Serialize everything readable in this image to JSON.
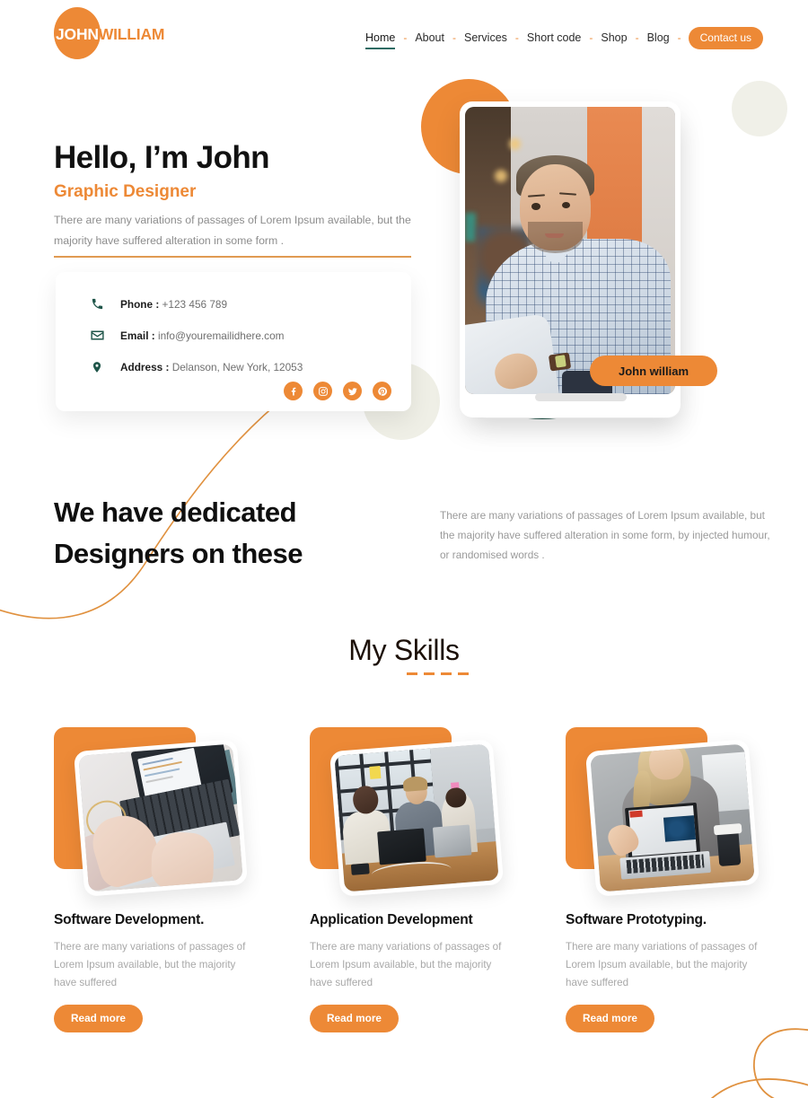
{
  "header": {
    "logo": {
      "word1": "JOHN",
      "word2": "WILLIAM"
    },
    "nav": {
      "separator": "-",
      "items": [
        {
          "label": "Home",
          "active": true
        },
        {
          "label": "About",
          "active": false
        },
        {
          "label": "Services",
          "active": false
        },
        {
          "label": "Short code",
          "active": false
        },
        {
          "label": "Shop",
          "active": false
        },
        {
          "label": "Blog",
          "active": false
        }
      ],
      "cta_label": "Contact us"
    }
  },
  "hero": {
    "title": "Hello, I’m John",
    "subtitle": "Graphic Designer",
    "paragraph": "There are many variations of passages of Lorem Ipsum available, but the majority have suffered alteration in some form .",
    "badge_label": "John william",
    "contact": {
      "phone_label": "Phone :",
      "phone_value": "+123 456 789",
      "email_label": "Email :",
      "email_value": "info@youremailidhere.com",
      "address_label": "Address :",
      "address_value": "Delanson, New York, 12053",
      "socials": [
        "facebook-icon",
        "instagram-icon",
        "twitter-icon",
        "pinterest-icon"
      ]
    }
  },
  "dedicated": {
    "title": "We have dedicated Designers on these",
    "paragraph": "There are many variations of passages of Lorem Ipsum available, but the majority have suffered alteration in some form, by injected humour, or randomised words ."
  },
  "skills": {
    "heading": "My Skills",
    "dash_count": 4,
    "cards": [
      {
        "title": "Software Development.",
        "description": "There are many variations of passages of Lorem Ipsum available, but the majority have suffered",
        "button_label": "Read more",
        "image": "hands-typing-on-laptop-photo"
      },
      {
        "title": "Application Development",
        "description": "There are many variations of passages of Lorem Ipsum available, but the majority have suffered",
        "button_label": "Read more",
        "image": "office-team-meeting-photo"
      },
      {
        "title": "Software Prototyping.",
        "description": "There are many variations of passages of Lorem Ipsum available, but the majority have suffered",
        "button_label": "Read more",
        "image": "woman-presenting-laptop-photo"
      }
    ]
  },
  "colors": {
    "accent_orange": "#ED8936",
    "dark_teal": "#1F5549",
    "nav_underline_teal": "#2E6B63",
    "beige_circle": "#EFEFE6",
    "body_text_grey": "#9a9a9a",
    "heading_black": "#111111"
  }
}
